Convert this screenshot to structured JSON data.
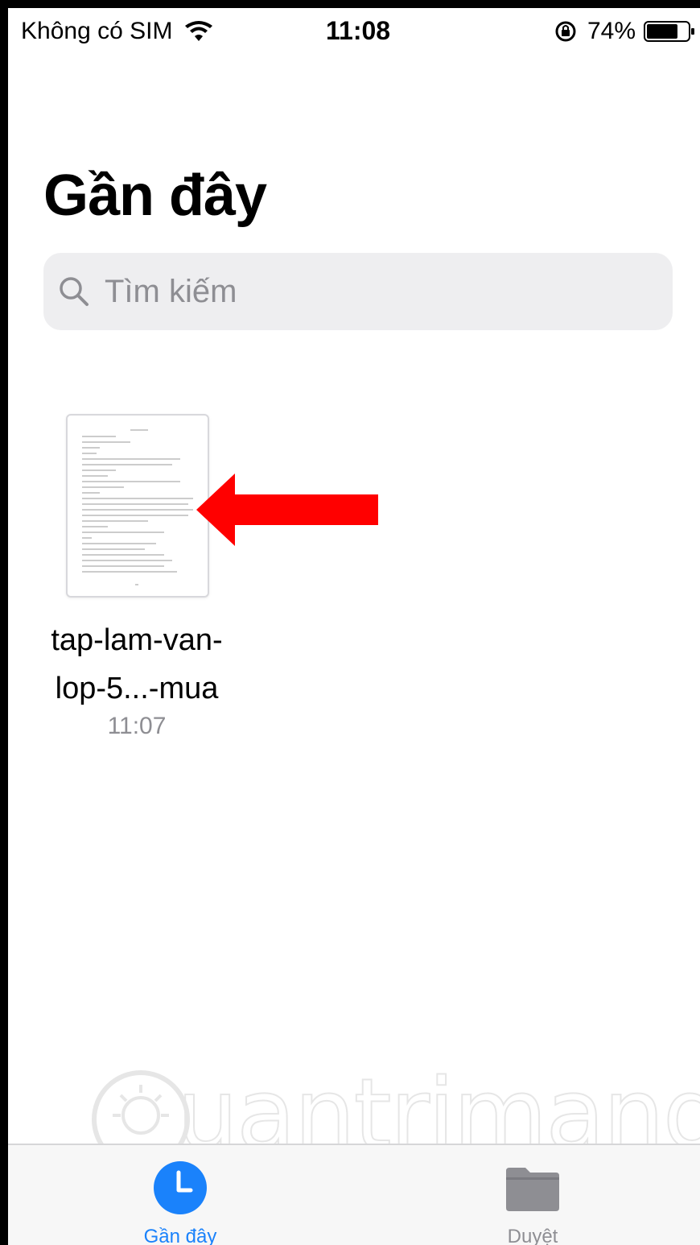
{
  "status_bar": {
    "carrier": "Không có SIM",
    "time": "11:08",
    "battery": "74%"
  },
  "page": {
    "title": "Gần đây"
  },
  "search": {
    "placeholder": "Tìm kiếm"
  },
  "files": [
    {
      "name_line1": "tap-lam-van-",
      "name_line2": "lop-5...-mua",
      "time": "11:07"
    }
  ],
  "tabs": [
    {
      "label": "Gần đây",
      "icon": "clock-icon",
      "active": true
    },
    {
      "label": "Duyệt",
      "icon": "folder-icon",
      "active": false
    }
  ],
  "watermark": {
    "text": "uantrimang"
  },
  "colors": {
    "accent": "#1a82fb",
    "arrow": "#ff0000",
    "search_bg": "#eeeef0",
    "secondary_text": "#8e8e93"
  }
}
